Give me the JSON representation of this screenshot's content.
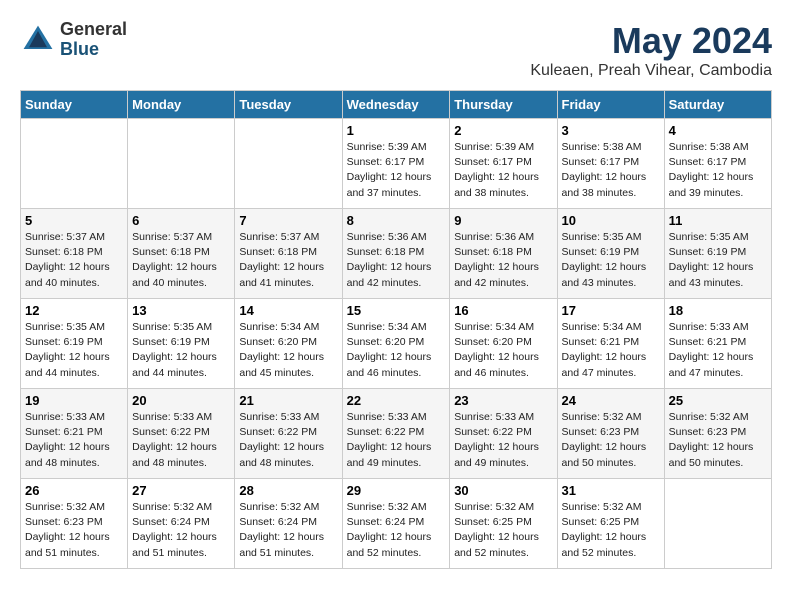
{
  "header": {
    "logo_general": "General",
    "logo_blue": "Blue",
    "month_year": "May 2024",
    "location": "Kuleaen, Preah Vihear, Cambodia"
  },
  "days_of_week": [
    "Sunday",
    "Monday",
    "Tuesday",
    "Wednesday",
    "Thursday",
    "Friday",
    "Saturday"
  ],
  "weeks": [
    [
      {
        "day": "",
        "info": ""
      },
      {
        "day": "",
        "info": ""
      },
      {
        "day": "",
        "info": ""
      },
      {
        "day": "1",
        "info": "Sunrise: 5:39 AM\nSunset: 6:17 PM\nDaylight: 12 hours\nand 37 minutes."
      },
      {
        "day": "2",
        "info": "Sunrise: 5:39 AM\nSunset: 6:17 PM\nDaylight: 12 hours\nand 38 minutes."
      },
      {
        "day": "3",
        "info": "Sunrise: 5:38 AM\nSunset: 6:17 PM\nDaylight: 12 hours\nand 38 minutes."
      },
      {
        "day": "4",
        "info": "Sunrise: 5:38 AM\nSunset: 6:17 PM\nDaylight: 12 hours\nand 39 minutes."
      }
    ],
    [
      {
        "day": "5",
        "info": "Sunrise: 5:37 AM\nSunset: 6:18 PM\nDaylight: 12 hours\nand 40 minutes."
      },
      {
        "day": "6",
        "info": "Sunrise: 5:37 AM\nSunset: 6:18 PM\nDaylight: 12 hours\nand 40 minutes."
      },
      {
        "day": "7",
        "info": "Sunrise: 5:37 AM\nSunset: 6:18 PM\nDaylight: 12 hours\nand 41 minutes."
      },
      {
        "day": "8",
        "info": "Sunrise: 5:36 AM\nSunset: 6:18 PM\nDaylight: 12 hours\nand 42 minutes."
      },
      {
        "day": "9",
        "info": "Sunrise: 5:36 AM\nSunset: 6:18 PM\nDaylight: 12 hours\nand 42 minutes."
      },
      {
        "day": "10",
        "info": "Sunrise: 5:35 AM\nSunset: 6:19 PM\nDaylight: 12 hours\nand 43 minutes."
      },
      {
        "day": "11",
        "info": "Sunrise: 5:35 AM\nSunset: 6:19 PM\nDaylight: 12 hours\nand 43 minutes."
      }
    ],
    [
      {
        "day": "12",
        "info": "Sunrise: 5:35 AM\nSunset: 6:19 PM\nDaylight: 12 hours\nand 44 minutes."
      },
      {
        "day": "13",
        "info": "Sunrise: 5:35 AM\nSunset: 6:19 PM\nDaylight: 12 hours\nand 44 minutes."
      },
      {
        "day": "14",
        "info": "Sunrise: 5:34 AM\nSunset: 6:20 PM\nDaylight: 12 hours\nand 45 minutes."
      },
      {
        "day": "15",
        "info": "Sunrise: 5:34 AM\nSunset: 6:20 PM\nDaylight: 12 hours\nand 46 minutes."
      },
      {
        "day": "16",
        "info": "Sunrise: 5:34 AM\nSunset: 6:20 PM\nDaylight: 12 hours\nand 46 minutes."
      },
      {
        "day": "17",
        "info": "Sunrise: 5:34 AM\nSunset: 6:21 PM\nDaylight: 12 hours\nand 47 minutes."
      },
      {
        "day": "18",
        "info": "Sunrise: 5:33 AM\nSunset: 6:21 PM\nDaylight: 12 hours\nand 47 minutes."
      }
    ],
    [
      {
        "day": "19",
        "info": "Sunrise: 5:33 AM\nSunset: 6:21 PM\nDaylight: 12 hours\nand 48 minutes."
      },
      {
        "day": "20",
        "info": "Sunrise: 5:33 AM\nSunset: 6:22 PM\nDaylight: 12 hours\nand 48 minutes."
      },
      {
        "day": "21",
        "info": "Sunrise: 5:33 AM\nSunset: 6:22 PM\nDaylight: 12 hours\nand 48 minutes."
      },
      {
        "day": "22",
        "info": "Sunrise: 5:33 AM\nSunset: 6:22 PM\nDaylight: 12 hours\nand 49 minutes."
      },
      {
        "day": "23",
        "info": "Sunrise: 5:33 AM\nSunset: 6:22 PM\nDaylight: 12 hours\nand 49 minutes."
      },
      {
        "day": "24",
        "info": "Sunrise: 5:32 AM\nSunset: 6:23 PM\nDaylight: 12 hours\nand 50 minutes."
      },
      {
        "day": "25",
        "info": "Sunrise: 5:32 AM\nSunset: 6:23 PM\nDaylight: 12 hours\nand 50 minutes."
      }
    ],
    [
      {
        "day": "26",
        "info": "Sunrise: 5:32 AM\nSunset: 6:23 PM\nDaylight: 12 hours\nand 51 minutes."
      },
      {
        "day": "27",
        "info": "Sunrise: 5:32 AM\nSunset: 6:24 PM\nDaylight: 12 hours\nand 51 minutes."
      },
      {
        "day": "28",
        "info": "Sunrise: 5:32 AM\nSunset: 6:24 PM\nDaylight: 12 hours\nand 51 minutes."
      },
      {
        "day": "29",
        "info": "Sunrise: 5:32 AM\nSunset: 6:24 PM\nDaylight: 12 hours\nand 52 minutes."
      },
      {
        "day": "30",
        "info": "Sunrise: 5:32 AM\nSunset: 6:25 PM\nDaylight: 12 hours\nand 52 minutes."
      },
      {
        "day": "31",
        "info": "Sunrise: 5:32 AM\nSunset: 6:25 PM\nDaylight: 12 hours\nand 52 minutes."
      },
      {
        "day": "",
        "info": ""
      }
    ]
  ]
}
